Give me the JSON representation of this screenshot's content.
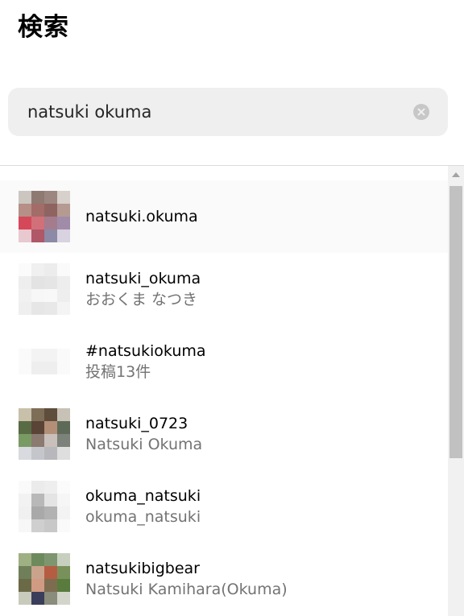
{
  "page": {
    "title": "検索"
  },
  "search": {
    "value": "natsuki okuma",
    "clear_icon": "clear-circle-icon"
  },
  "results": [
    {
      "primary": "natsuki.okuma",
      "secondary": ""
    },
    {
      "primary": "natsuki_okuma",
      "secondary": "おおくま なつき"
    },
    {
      "primary": "#natsukiokuma",
      "secondary": "投稿13件"
    },
    {
      "primary": "natsuki_0723",
      "secondary": "Natsuki Okuma"
    },
    {
      "primary": "okuma_natsuki",
      "secondary": "okuma_natsuki"
    },
    {
      "primary": "natsukibigbear",
      "secondary": "Natsuki Kamihara(Okuma)"
    }
  ],
  "colors": {
    "search_bg": "#efefef",
    "secondary_text": "#737373",
    "active_row": "#fafafa",
    "scroll_thumb": "#c1c1c1"
  }
}
